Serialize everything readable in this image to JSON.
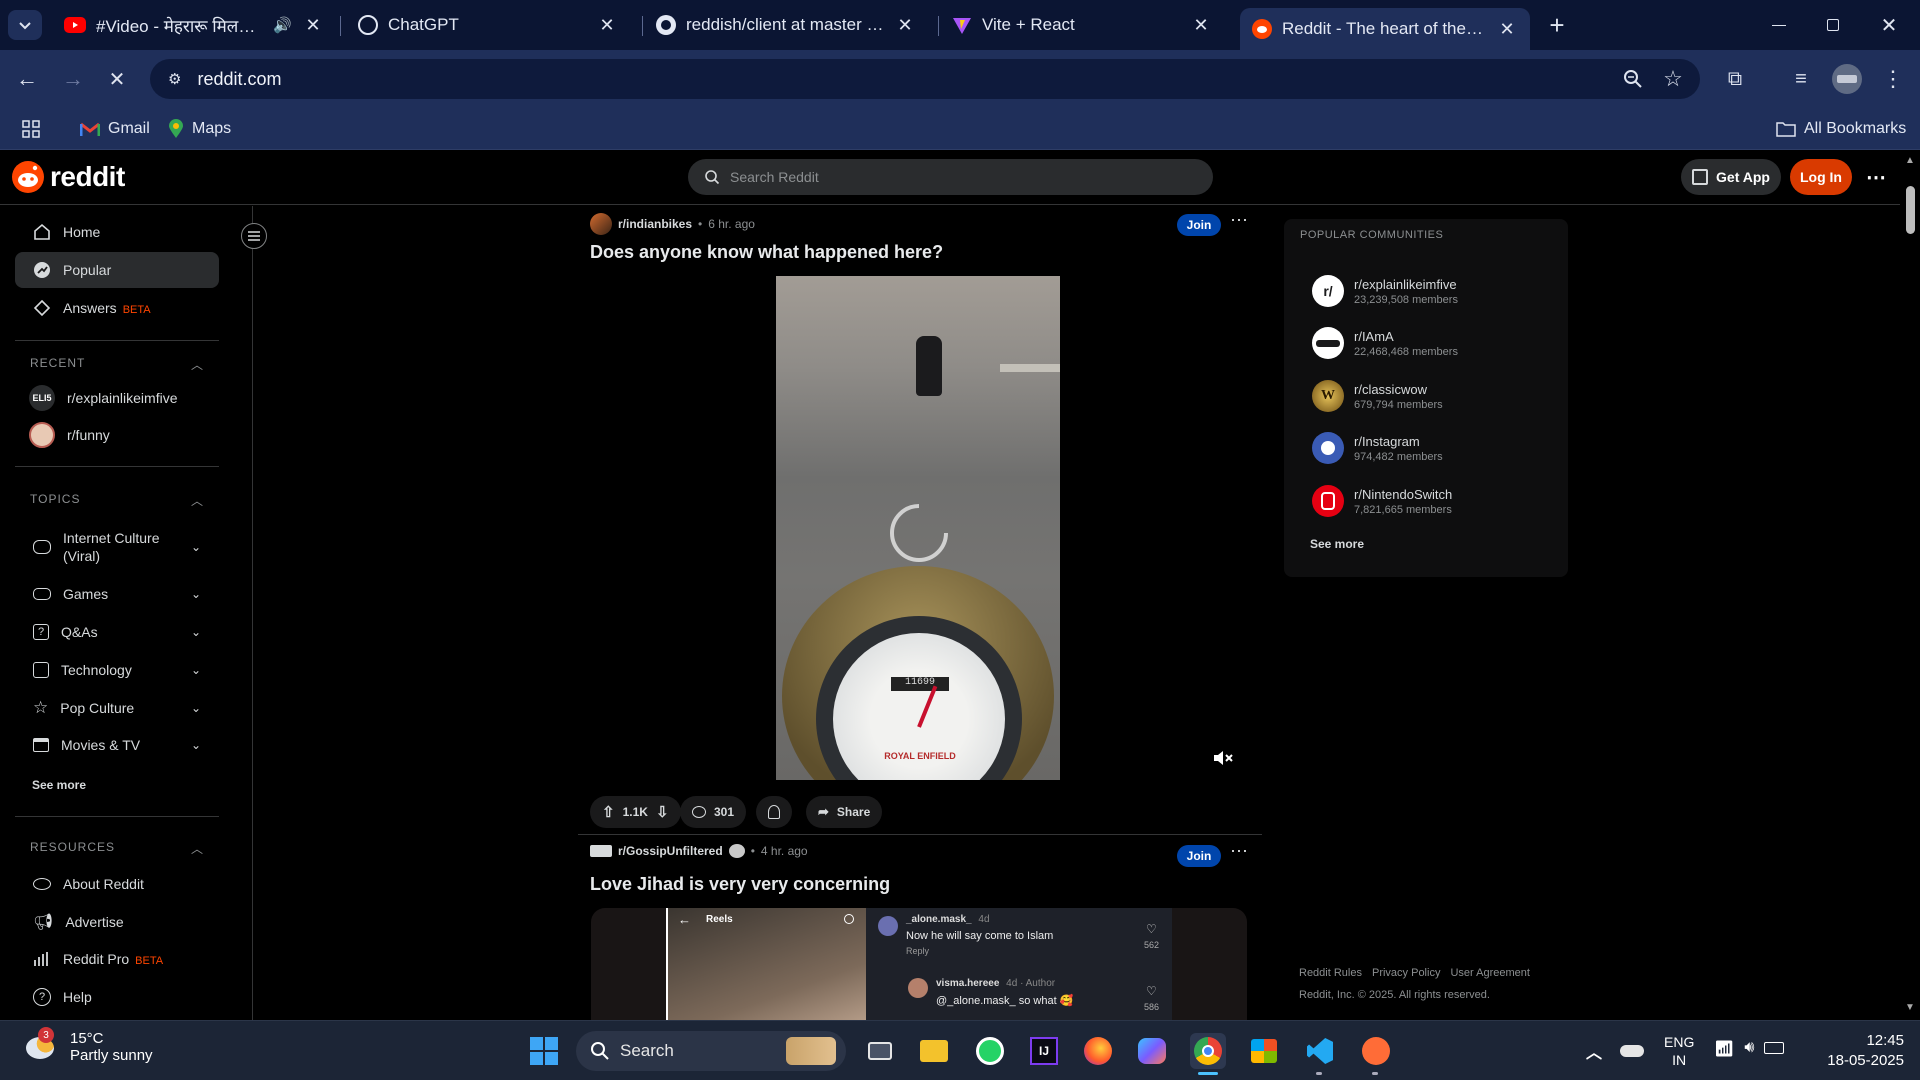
{
  "browser": {
    "tabs": [
      {
        "title": "#Video - मेहरारू मिलत गाए",
        "icon": "youtube-icon",
        "audio": true
      },
      {
        "title": "ChatGPT",
        "icon": "chatgpt-icon"
      },
      {
        "title": "reddish/client at master · amanc",
        "icon": "github-icon"
      },
      {
        "title": "Vite + React",
        "icon": "vite-icon"
      },
      {
        "title": "Reddit - The heart of the interne",
        "icon": "reddit-icon",
        "active": true
      }
    ],
    "new_tab": "+",
    "url": "reddit.com",
    "bookmarks": {
      "gmail": "Gmail",
      "maps": "Maps",
      "all": "All Bookmarks"
    }
  },
  "reddit": {
    "logo_text": "reddit",
    "search_placeholder": "Search Reddit",
    "get_app": "Get App",
    "login": "Log In",
    "nav": {
      "home": "Home",
      "popular": "Popular",
      "answers": "Answers",
      "answers_badge": "BETA"
    },
    "recent": {
      "header": "RECENT",
      "items": [
        {
          "name": "r/explainlikeimfive",
          "avatar": "ELI5"
        },
        {
          "name": "r/funny",
          "avatar": ""
        }
      ]
    },
    "topics": {
      "header": "TOPICS",
      "items": [
        {
          "label": "Internet Culture (Viral)"
        },
        {
          "label": "Games"
        },
        {
          "label": "Q&As"
        },
        {
          "label": "Technology"
        },
        {
          "label": "Pop Culture"
        },
        {
          "label": "Movies & TV"
        }
      ],
      "see_more": "See more"
    },
    "resources": {
      "header": "RESOURCES",
      "items": [
        {
          "label": "About Reddit"
        },
        {
          "label": "Advertise"
        },
        {
          "label": "Reddit Pro",
          "badge": "BETA"
        },
        {
          "label": "Help"
        }
      ]
    },
    "posts": [
      {
        "subreddit": "r/indianbikes",
        "time": "6 hr. ago",
        "title": "Does anyone know what happened here?",
        "join": "Join",
        "upvotes": "1.1K",
        "comments": "301",
        "share": "Share",
        "speedo_text": "ROYAL ENFIELD",
        "odometer": "11699"
      },
      {
        "subreddit": "r/GossipUnfiltered",
        "time": "4 hr. ago",
        "title": "Love Jihad is very very concerning",
        "join": "Join",
        "reels": {
          "header": "Reels",
          "c1_user": "_alone.mask_",
          "c1_age": "4d",
          "c1_text": "Now he will say come to Islam",
          "c1_reply": "Reply",
          "c1_likes": "562",
          "c2_user": "visma.hereee",
          "c2_meta": "4d · Author",
          "c2_text": "@_alone.mask_ so what 🥰",
          "c2_likes": "586"
        }
      }
    ],
    "popular_communities": {
      "header": "POPULAR COMMUNITIES",
      "items": [
        {
          "name": "r/explainlikeimfive",
          "members": "23,239,508 members"
        },
        {
          "name": "r/IAmA",
          "members": "22,468,468 members"
        },
        {
          "name": "r/classicwow",
          "members": "679,794 members"
        },
        {
          "name": "r/Instagram",
          "members": "974,482 members"
        },
        {
          "name": "r/NintendoSwitch",
          "members": "7,821,665 members"
        }
      ],
      "see_more": "See more"
    },
    "footer": {
      "rules": "Reddit Rules",
      "privacy": "Privacy Policy",
      "agreement": "User Agreement",
      "copyright": "Reddit, Inc. © 2025. All rights reserved."
    }
  },
  "taskbar": {
    "weather_temp": "15°C",
    "weather_desc": "Partly sunny",
    "weather_badge": "3",
    "search": "Search",
    "lang1": "ENG",
    "lang2": "IN",
    "time": "12:45",
    "date": "18-05-2025"
  },
  "colors": {
    "reddit_orange": "#ff4500",
    "join_blue": "#0045ac",
    "chrome_frame": "#0b1533",
    "chrome_toolbar": "#1f2f5a"
  }
}
